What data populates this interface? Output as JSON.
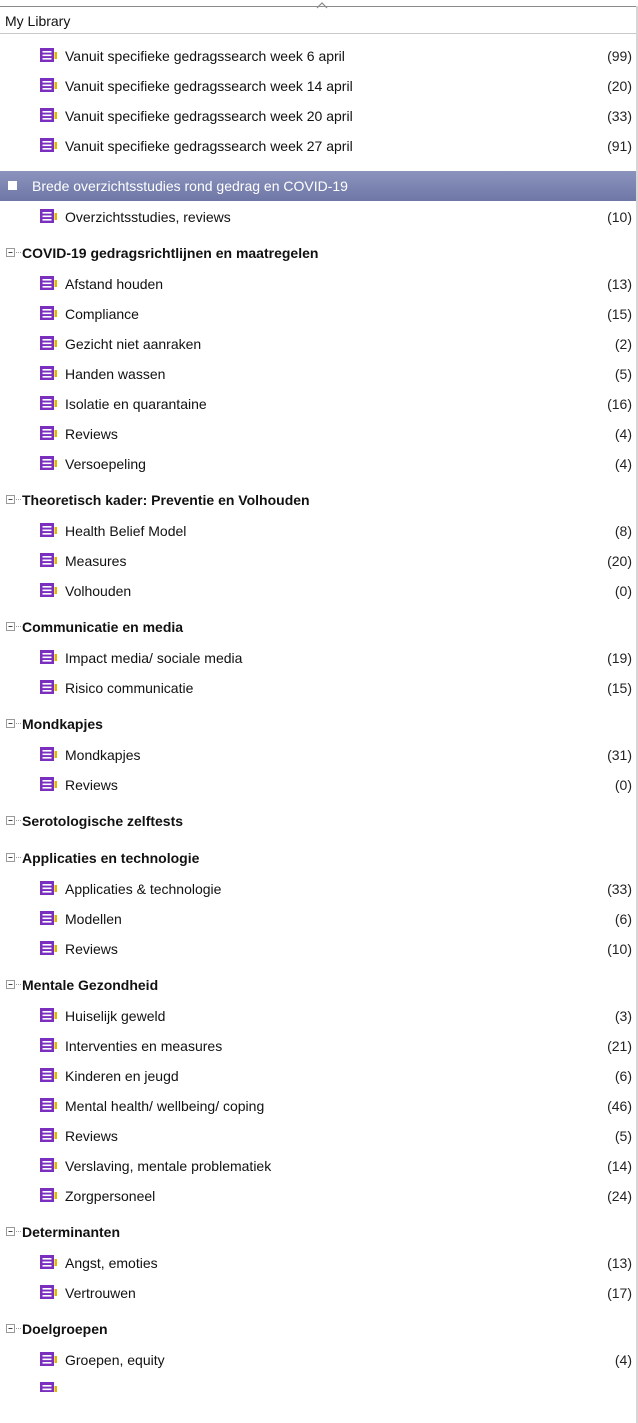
{
  "header": {
    "title": "My Library"
  },
  "top_items": [
    {
      "label": "Vanuit specifieke gedragssearch week 6 april",
      "count": "(99)"
    },
    {
      "label": "Vanuit specifieke gedragssearch week 14 april",
      "count": "(20)"
    },
    {
      "label": "Vanuit specifieke gedragssearch week 20 april",
      "count": "(33)"
    },
    {
      "label": "Vanuit specifieke gedragssearch week 27 april",
      "count": "(91)"
    }
  ],
  "groups": [
    {
      "label": "Brede overzichtsstudies rond gedrag en COVID-19",
      "selected": true,
      "items": [
        {
          "label": "Overzichtsstudies, reviews",
          "count": "(10)"
        }
      ]
    },
    {
      "label": "COVID-19 gedragsrichtlijnen en maatregelen",
      "items": [
        {
          "label": "Afstand houden",
          "count": "(13)"
        },
        {
          "label": "Compliance",
          "count": "(15)"
        },
        {
          "label": "Gezicht niet aanraken",
          "count": "(2)"
        },
        {
          "label": "Handen wassen",
          "count": "(5)"
        },
        {
          "label": "Isolatie en quarantaine",
          "count": "(16)"
        },
        {
          "label": "Reviews",
          "count": "(4)"
        },
        {
          "label": "Versoepeling",
          "count": "(4)"
        }
      ]
    },
    {
      "label": "Theoretisch kader: Preventie en Volhouden",
      "items": [
        {
          "label": "Health Belief Model",
          "count": "(8)"
        },
        {
          "label": "Measures",
          "count": "(20)"
        },
        {
          "label": "Volhouden",
          "count": "(0)"
        }
      ]
    },
    {
      "label": "Communicatie en media",
      "items": [
        {
          "label": "Impact media/ sociale media",
          "count": "(19)"
        },
        {
          "label": "Risico communicatie",
          "count": "(15)"
        }
      ]
    },
    {
      "label": "Mondkapjes",
      "items": [
        {
          "label": "Mondkapjes",
          "count": "(31)"
        },
        {
          "label": "Reviews",
          "count": "(0)"
        }
      ]
    },
    {
      "label": "Serotologische zelftests",
      "items": []
    },
    {
      "label": "Applicaties en technologie",
      "items": [
        {
          "label": "Applicaties & technologie",
          "count": "(33)"
        },
        {
          "label": "Modellen",
          "count": "(6)"
        },
        {
          "label": "Reviews",
          "count": "(10)"
        }
      ]
    },
    {
      "label": "Mentale Gezondheid",
      "items": [
        {
          "label": "Huiselijk geweld",
          "count": "(3)"
        },
        {
          "label": "Interventies en measures",
          "count": "(21)"
        },
        {
          "label": "Kinderen en jeugd",
          "count": "(6)"
        },
        {
          "label": "Mental health/ wellbeing/ coping",
          "count": "(46)"
        },
        {
          "label": "Reviews",
          "count": "(5)"
        },
        {
          "label": "Verslaving, mentale problematiek",
          "count": "(14)"
        },
        {
          "label": "Zorgpersoneel",
          "count": "(24)"
        }
      ]
    },
    {
      "label": "Determinanten",
      "items": [
        {
          "label": "Angst, emoties",
          "count": "(13)"
        },
        {
          "label": "Vertrouwen",
          "count": "(17)"
        }
      ]
    },
    {
      "label": "Doelgroepen",
      "items": [
        {
          "label": "Groepen, equity",
          "count": "(4)"
        }
      ]
    }
  ],
  "colors": {
    "selection": "#7c84b2",
    "group_icon": "#7b2fbf",
    "group_icon_tab": "#e0b400"
  },
  "icons": {
    "group": "group-list-icon",
    "expander": "collapse-tree-icon",
    "header_arrow": "chevron-up-icon"
  }
}
